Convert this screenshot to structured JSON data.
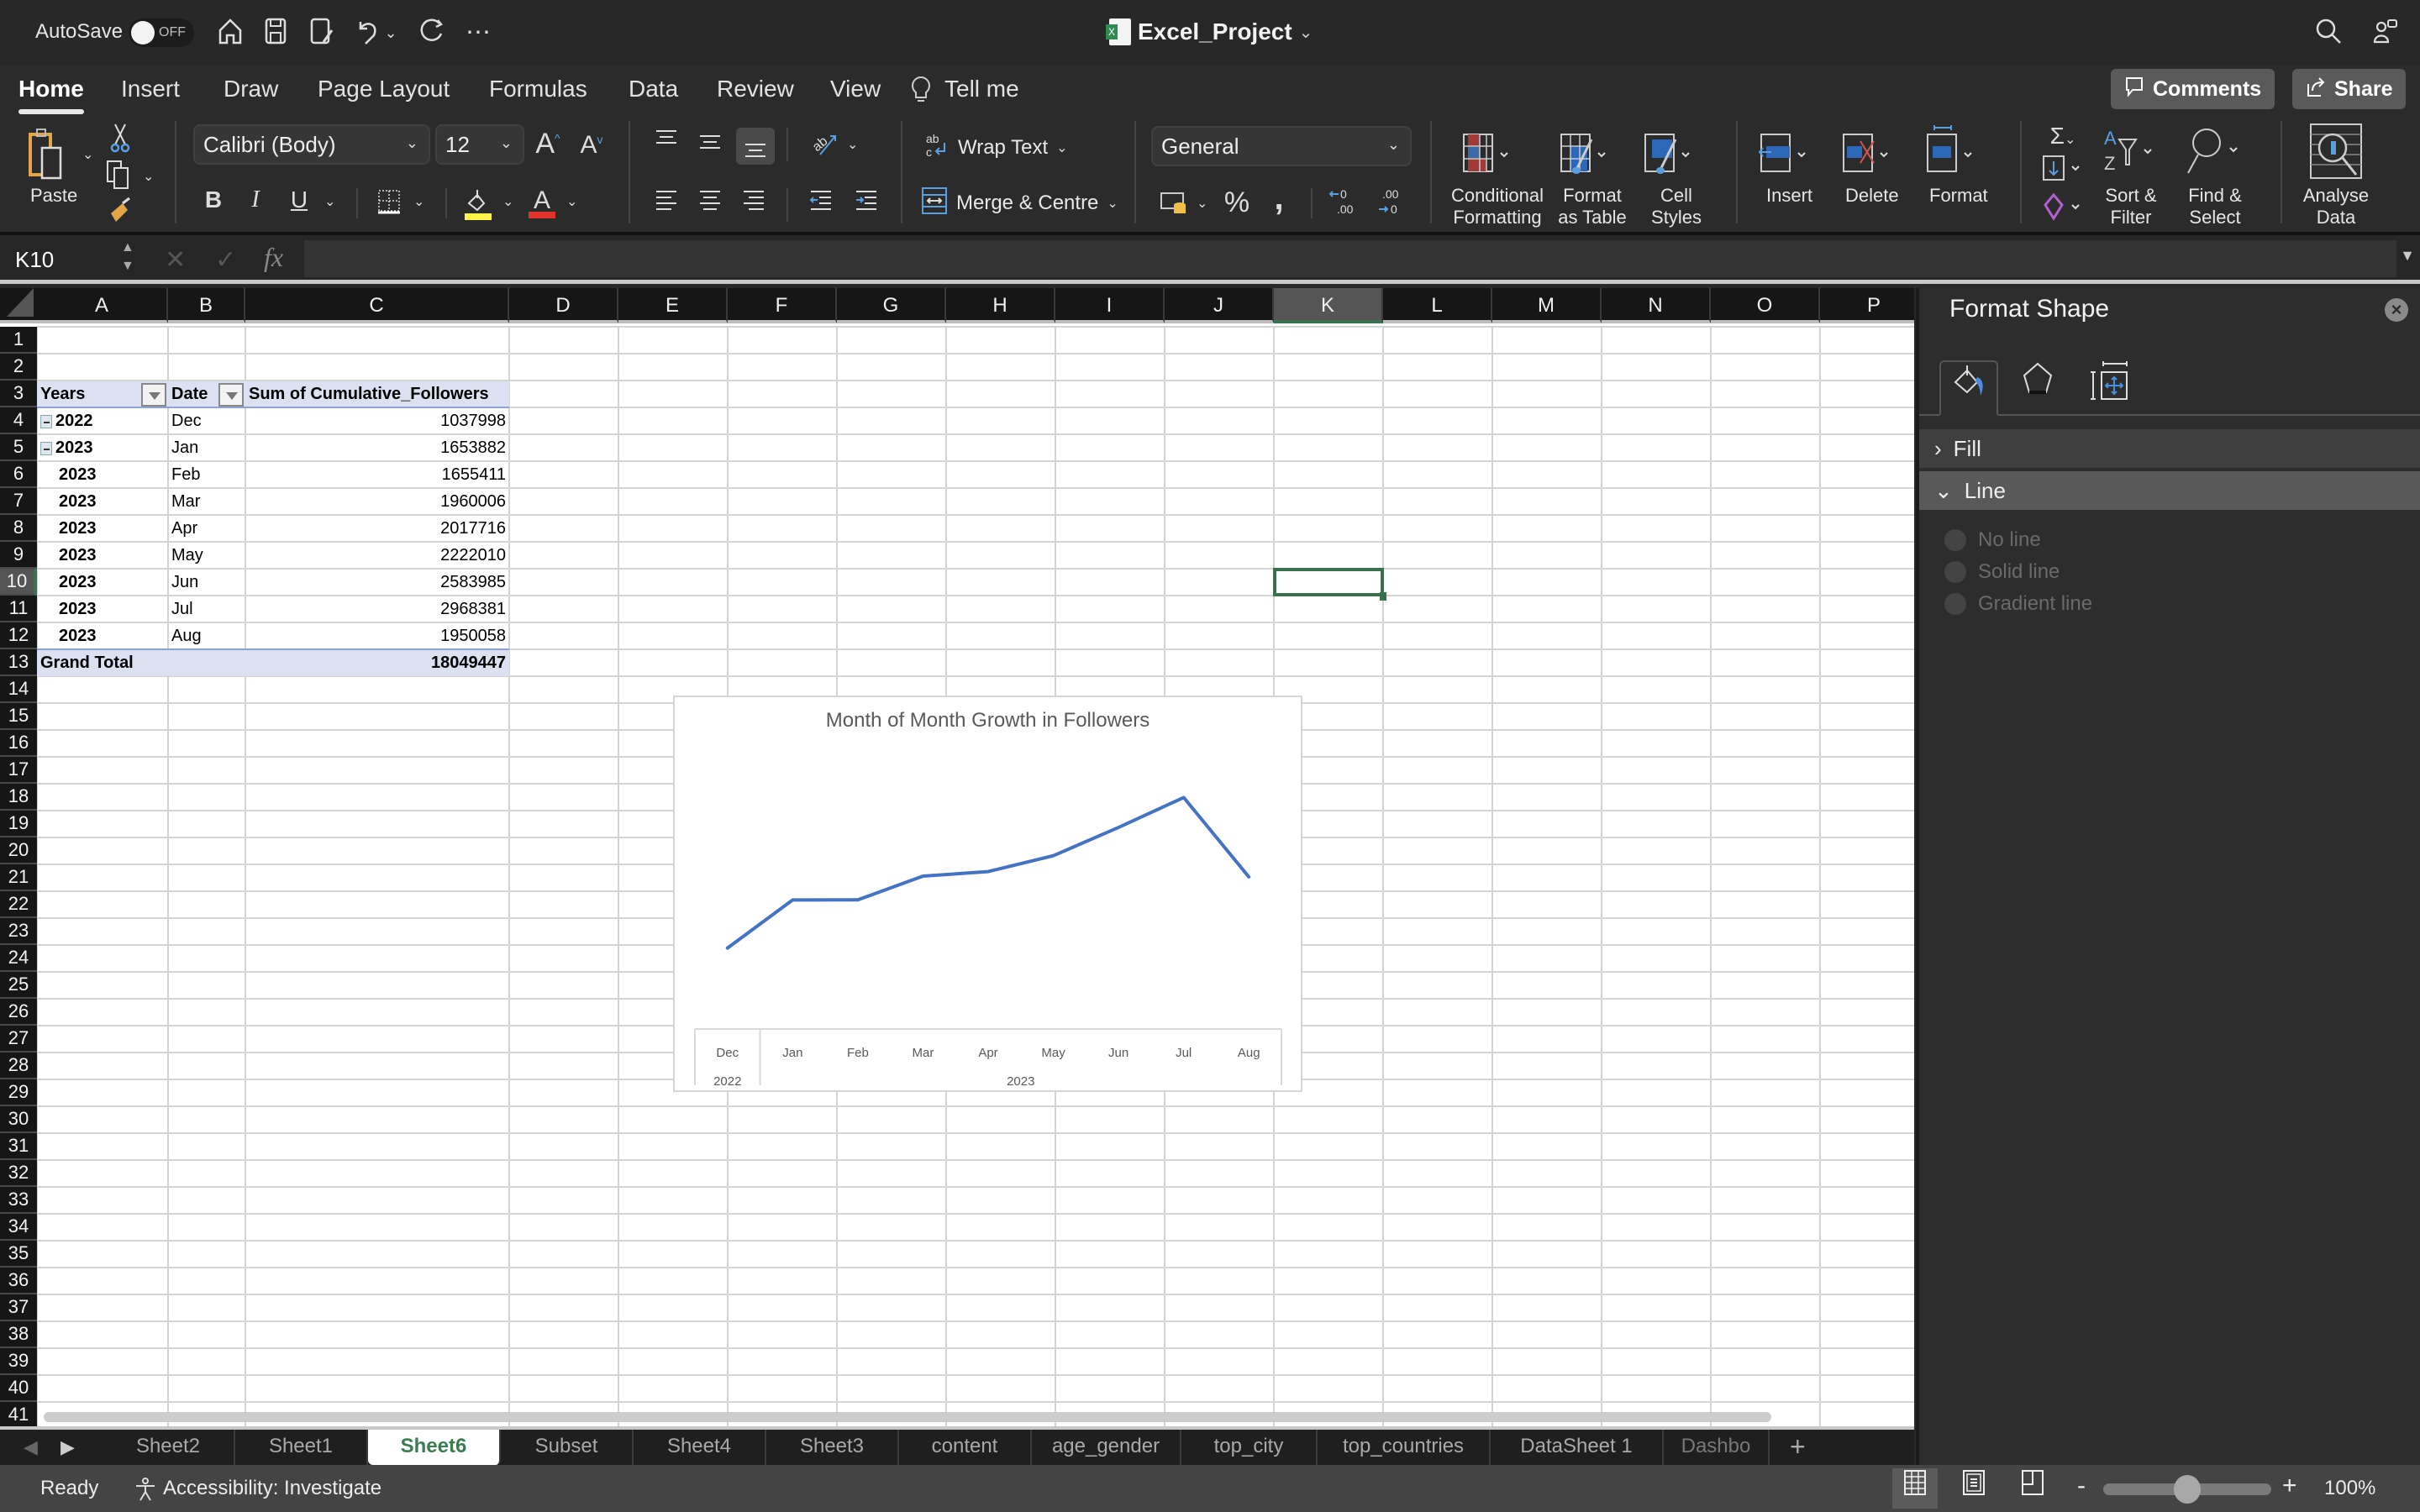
{
  "titlebar": {
    "autosave_label": "AutoSave",
    "autosave_state": "OFF",
    "doc_title": "Excel_Project",
    "quick_access": [
      "home-icon",
      "save-icon",
      "save-as-icon",
      "undo-icon",
      "redo-icon",
      "more-icon"
    ]
  },
  "menu": {
    "tabs": [
      "Home",
      "Insert",
      "Draw",
      "Page Layout",
      "Formulas",
      "Data",
      "Review",
      "View"
    ],
    "active": "Home",
    "tell_me": "Tell me",
    "comments": "Comments",
    "share": "Share"
  },
  "ribbon": {
    "paste": "Paste",
    "font_name": "Calibri (Body)",
    "font_size": "12",
    "bold": "B",
    "italic": "I",
    "underline": "U",
    "wrap_text": "Wrap Text",
    "merge_centre": "Merge & Centre",
    "number_format": "General",
    "percent": "%",
    "comma": ",",
    "conditional_formatting": [
      "Conditional",
      "Formatting"
    ],
    "format_as_table": [
      "Format",
      "as Table"
    ],
    "cell_styles": [
      "Cell",
      "Styles"
    ],
    "insert": "Insert",
    "delete": "Delete",
    "format": "Format",
    "sort_filter": [
      "Sort &",
      "Filter"
    ],
    "find_select": [
      "Find &",
      "Select"
    ],
    "analyse_data": [
      "Analyse",
      "Data"
    ],
    "colors": {
      "highlight": "#fdf64a",
      "font_color": "#e0332b"
    }
  },
  "formula_bar": {
    "name_box": "K10",
    "fx": "fx",
    "formula": ""
  },
  "grid": {
    "columns": [
      "A",
      "B",
      "C",
      "D",
      "E",
      "F",
      "G",
      "H",
      "I",
      "J",
      "K",
      "L",
      "M",
      "N",
      "O",
      "P"
    ],
    "selected_column": "K",
    "selected_row": 10,
    "rows": [
      "1",
      "2",
      "3",
      "4",
      "5",
      "6",
      "7",
      "8",
      "9",
      "10",
      "11",
      "12",
      "13",
      "14",
      "15",
      "16",
      "17",
      "18",
      "19",
      "20",
      "21",
      "22",
      "23",
      "24",
      "25",
      "26",
      "27",
      "28",
      "29",
      "30",
      "31",
      "32",
      "33",
      "34",
      "35",
      "36",
      "37",
      "38",
      "39",
      "40",
      "41"
    ]
  },
  "pivot": {
    "headers": [
      "Years",
      "Date",
      "Sum of Cumulative_Followers"
    ],
    "rows": [
      {
        "year": "2022",
        "month": "Dec",
        "value": "1037998",
        "collapse": true
      },
      {
        "year": "2023",
        "month": "Jan",
        "value": "1653882",
        "collapse": true
      },
      {
        "year": "2023",
        "month": "Feb",
        "value": "1655411",
        "collapse": false
      },
      {
        "year": "2023",
        "month": "Mar",
        "value": "1960006",
        "collapse": false
      },
      {
        "year": "2023",
        "month": "Apr",
        "value": "2017716",
        "collapse": false
      },
      {
        "year": "2023",
        "month": "May",
        "value": "2222010",
        "collapse": false
      },
      {
        "year": "2023",
        "month": "Jun",
        "value": "2583985",
        "collapse": false
      },
      {
        "year": "2023",
        "month": "Jul",
        "value": "2968381",
        "collapse": false
      },
      {
        "year": "2023",
        "month": "Aug",
        "value": "1950058",
        "collapse": false
      }
    ],
    "total_label": "Grand Total",
    "total_value": "18049447"
  },
  "chart_data": {
    "type": "line",
    "title": "Month of Month Growth in Followers",
    "categories": [
      "Dec",
      "Jan",
      "Feb",
      "Mar",
      "Apr",
      "May",
      "Jun",
      "Jul",
      "Aug"
    ],
    "category_groups": [
      {
        "label": "2022",
        "span": 1
      },
      {
        "label": "2023",
        "span": 8
      }
    ],
    "series": [
      {
        "name": "Sum of Cumulative_Followers",
        "color": "#4472c4",
        "values": [
          1037998,
          1653882,
          1655411,
          1960006,
          2017716,
          2222010,
          2583985,
          2968381,
          1950058
        ]
      }
    ],
    "ylim": [
      0,
      3500000
    ],
    "xlabel": "",
    "ylabel": "",
    "grid": false,
    "legend": "none"
  },
  "sheet_tabs": {
    "tabs": [
      "Sheet2",
      "Sheet1",
      "Sheet6",
      "Subset",
      "Sheet4",
      "Sheet3",
      "content",
      "age_gender",
      "top_city",
      "top_countries",
      "DataSheet 1",
      "Dashbo"
    ],
    "active": "Sheet6",
    "add": "+"
  },
  "status": {
    "ready": "Ready",
    "accessibility": "Accessibility: Investigate",
    "zoom": "100%",
    "zoom_percent": 100
  },
  "format_pane": {
    "title": "Format Shape",
    "tabs": [
      "fill-line-icon",
      "effects-icon",
      "size-properties-icon"
    ],
    "sections": [
      {
        "label": "Fill",
        "expanded": false
      },
      {
        "label": "Line",
        "expanded": true
      }
    ],
    "line_options": [
      "No line",
      "Solid line",
      "Gradient line"
    ]
  }
}
